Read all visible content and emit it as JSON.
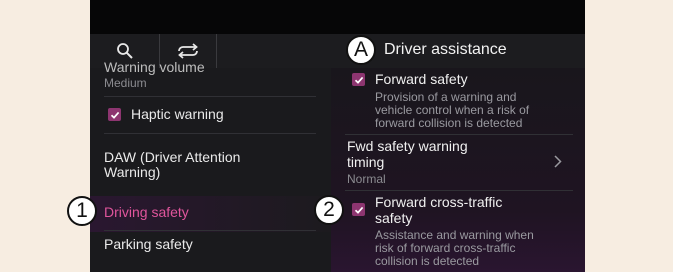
{
  "header": {
    "title": "Driver assistance",
    "search_icon": "search-icon",
    "swap_icon": "swap-arrows-icon"
  },
  "left_menu": {
    "partial_item_label": "Warning volume",
    "partial_item_value": "Medium",
    "haptic_label": "Haptic warning",
    "haptic_checked": true,
    "daw_line1": "DAW (Driver Attention",
    "daw_line2": "Warning)",
    "driving_safety": "Driving safety",
    "parking_safety": "Parking safety"
  },
  "right_panel": {
    "forward_safety_label": "Forward safety",
    "forward_safety_checked": true,
    "forward_safety_desc": [
      "Provision of a warning and",
      "vehicle control when a risk of",
      "forward collision is detected"
    ],
    "fwd_timing_line1": "Fwd safety warning",
    "fwd_timing_line2": "timing",
    "fwd_timing_value": "Normal",
    "cross_traffic_line1": "Forward cross-traffic",
    "cross_traffic_line2": "safety",
    "cross_traffic_checked": true,
    "cross_traffic_desc": [
      "Assistance and warning when",
      "risk of forward cross-traffic",
      "collision is detected"
    ]
  },
  "callouts": {
    "a": "A",
    "one": "1",
    "two": "2"
  },
  "colors": {
    "accent": "#e0559c",
    "checkbox": "#8d3570",
    "background": "#161618"
  }
}
